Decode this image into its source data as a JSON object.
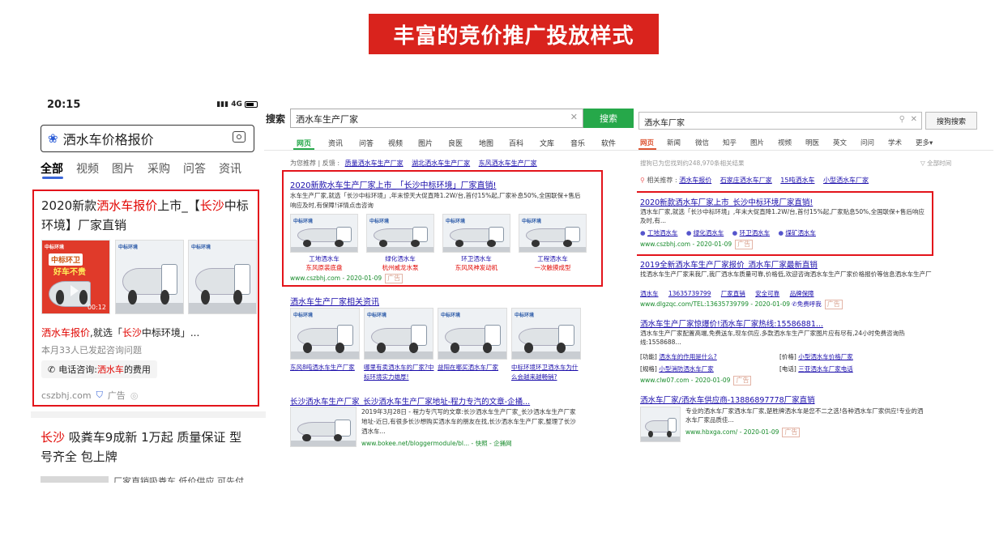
{
  "title": "丰富的竞价推广投放样式",
  "mobile": {
    "time": "20:15",
    "signal": "4G",
    "query": "洒水车价格报价",
    "tabs": [
      "全部",
      "视频",
      "图片",
      "采购",
      "问答",
      "资讯"
    ],
    "ad": {
      "title_a": "2020新款",
      "title_b": "洒水车报价",
      "title_c": "上市_【",
      "title_d": "长沙",
      "title_e": "中标环境】厂家直销",
      "img_badge_1": "中标环卫",
      "img_badge_2": "好车不贵",
      "video_time": "00:12",
      "desc_a": "洒水车报价",
      "desc_b": ",就选「",
      "desc_c": "长沙",
      "desc_d": "中标环境」...",
      "consult": "本月33人已发起咨询问题",
      "phone_label": "电话咨询:",
      "phone_hl": "洒水车",
      "phone_rest": "的费用",
      "domain": "cszbhj.com",
      "ad_label": "广告"
    },
    "next": {
      "title_a": "长沙",
      "title_b": " 吸粪车9成新 1万起 质量保证 型号齐全 包上牌",
      "sub": "厂家直销吸粪车 低价供应 可先付"
    },
    "logo_text": "中标环境"
  },
  "sogou": {
    "search_label": "搜索",
    "query": "洒水车生产厂家",
    "btn": "搜索",
    "nav": [
      "网页",
      "资讯",
      "问答",
      "视频",
      "图片",
      "良医",
      "地图",
      "百科",
      "文库",
      "音乐",
      "软件"
    ],
    "recommend_label": "为您推荐 | 反馈 :",
    "recommend": [
      "质量洒水车生产厂家",
      "湖北洒水车生产厂家",
      "东风洒水车生产厂家"
    ],
    "ad": {
      "title": "2020新款水车生产厂家上市_「长沙中标环境」厂家直销!",
      "desc": "水车生产厂家,就选「长沙中标环境」,年末惊天大促直降1.2W/台,首付15%起,厂家补息50%,全国联保+售后响应及时,有保障!详情点击咨询",
      "products": [
        {
          "name": "工地洒水车",
          "desc": "东风原装底盘"
        },
        {
          "name": "绿化洒水车",
          "desc": "杭州威龙水泵"
        },
        {
          "name": "环卫洒水车",
          "desc": "东风风神发动机"
        },
        {
          "name": "工程洒水车",
          "desc": "一次触摸成型"
        }
      ],
      "url": "www.cszbhj.com - 2020-01-09",
      "ad_label": "广告"
    },
    "news_title": "洒水车生产厂家相关资讯",
    "news": [
      "东风8吨洒水车生产厂家",
      "哪里有卖洒水车的厂家?中标环境实力雄厚!",
      "益阳在哪买洒水车厂家",
      "中标环境环卫洒水车为什么会越来越畅销?"
    ],
    "result": {
      "title": "长沙洒水车生产厂家_长沙洒水车生产厂家地址-程力专汽的文章-企捅...",
      "desc": "2019年3月28日 - 程力专汽写的文章:长沙洒水车生产厂家_长沙洒水车生产厂家地址-近日,有很多长沙想购买洒水车的朋友在找,长沙洒水车生产厂家,整理了长沙洒水车...",
      "url": "www.bokee.net/bloggermodule/bl... - 快照 - 企捅网"
    }
  },
  "sogou2": {
    "query": "洒水车厂家",
    "btn": "搜狗搜索",
    "nav": [
      "网页",
      "新闻",
      "微信",
      "知乎",
      "图片",
      "视频",
      "明医",
      "英文",
      "问问",
      "学术",
      "更多▾"
    ],
    "count": "搜狗已为您找到约248,970条相关结果",
    "filter": "全部时间",
    "related_label": "相关推荐 :",
    "related": [
      "洒水车报价",
      "石家庄洒水车厂家",
      "15吨洒水车",
      "小型洒水车厂家"
    ],
    "ad": {
      "title": "2020新款洒水车厂家上市_长沙中标环境厂家直销!",
      "desc": "洒水车厂家,就选「长沙中标环境」,年末大促直降1.2W/台,首付15%起,厂家贴息50%,全国联保+售后响应及时,有...",
      "links": [
        "工地洒水车",
        "绿化洒水车",
        "环卫洒水车",
        "煤矿洒水车"
      ],
      "url": "www.cszbhj.com - 2020-01-09",
      "ad_label": "广告"
    },
    "r1": {
      "title": "2019全新洒水车生产厂家报价_洒水车厂家最新直销",
      "desc": "找洒水车生产厂家来我厂,我厂洒水车质量可靠,价格低,欢迎咨询洒水车生产厂家价格报价等信息洒水车生产厂",
      "links": [
        "洒水车",
        "13635739799",
        "厂家直销",
        "安全可靠",
        "品牌保障"
      ],
      "url": "www.dlgzqc.com/TEL:13635739799 - 2020-01-09",
      "call": "免费呼我",
      "ad_label": "广告"
    },
    "r2": {
      "title": "洒水车生产厂家惊爆价!洒水车厂家热线:15586881...",
      "desc": "洒水车生产厂家配置高端,免费送车,现车供应.多款洒水车生产厂家图片应有尽有,24小时免费咨询热线:1558688...",
      "k1": "[功能]",
      "v1": "洒水车的作用是什么?",
      "k2": "[价格]",
      "v2": "小型洒水车价格厂家",
      "k3": "[规格]",
      "v3": "小型消防洒水车厂家",
      "k4": "[电话]",
      "v4": "三亚洒水车厂家电话",
      "url": "www.clw07.com - 2020-01-09",
      "ad_label": "广告"
    },
    "r3": {
      "title": "洒水车厂家/洒水车供应商-13886897778厂家直销",
      "desc": "专业的洒水车厂家洒水车厂家,楚胜牌洒水车是您不二之选!各种洒水车厂家供应!专业的洒水车厂家品质佳...",
      "url": "www.hbxga.com/ - 2020-01-09",
      "ad_label": "广告"
    }
  }
}
